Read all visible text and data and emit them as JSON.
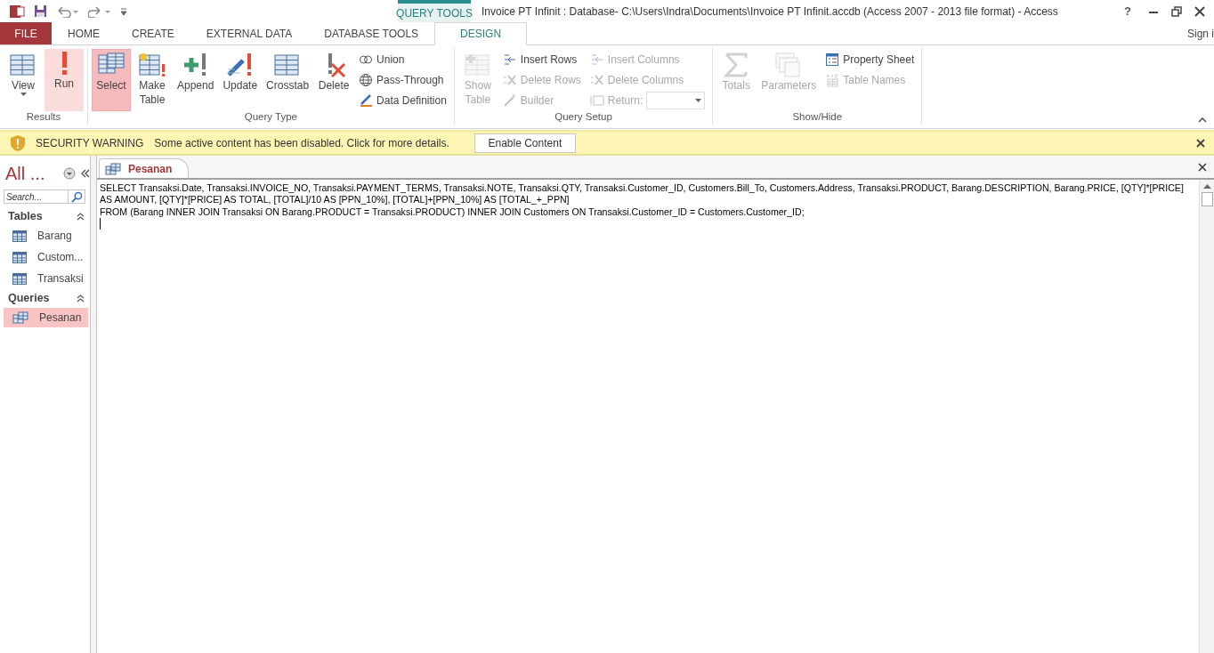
{
  "title_bar": {
    "context_tab": "QUERY TOOLS",
    "title": "Invoice PT Infinit : Database- C:\\Users\\Indra\\Documents\\Invoice PT Infinit.accdb (Access 2007 - 2013 file format) - Access",
    "help": "?"
  },
  "ribbon_tabs": [
    {
      "label": "FILE",
      "kind": "file",
      "selected": false
    },
    {
      "label": "HOME",
      "kind": "tab",
      "selected": false
    },
    {
      "label": "CREATE",
      "kind": "tab",
      "selected": false
    },
    {
      "label": "EXTERNAL DATA",
      "kind": "tab",
      "selected": false
    },
    {
      "label": "DATABASE TOOLS",
      "kind": "tab",
      "selected": false
    },
    {
      "label": "DESIGN",
      "kind": "tab",
      "selected": true
    }
  ],
  "sign_in": "Sign i",
  "ribbon_groups": [
    {
      "label": "Results",
      "items": [
        {
          "label": "View",
          "kind": "large",
          "selected": false,
          "highlighted": false,
          "disabled": false,
          "dropdown": true
        },
        {
          "label": "Run",
          "kind": "large",
          "selected": false,
          "highlighted": true,
          "disabled": false
        }
      ]
    },
    {
      "label": "Query Type",
      "items": [
        {
          "label": "Select",
          "kind": "large",
          "selected": true,
          "highlighted": false,
          "disabled": false
        },
        {
          "label": "Make Table",
          "kind": "large",
          "selected": false,
          "highlighted": false,
          "disabled": false
        },
        {
          "label": "Append",
          "kind": "large",
          "selected": false,
          "highlighted": false,
          "disabled": false
        },
        {
          "label": "Update",
          "kind": "large",
          "selected": false,
          "highlighted": false,
          "disabled": false
        },
        {
          "label": "Crosstab",
          "kind": "large",
          "selected": false,
          "highlighted": false,
          "disabled": false
        },
        {
          "label": "Delete",
          "kind": "large",
          "selected": false,
          "highlighted": false,
          "disabled": false
        },
        {
          "label": "Union",
          "kind": "small",
          "disabled": false
        },
        {
          "label": "Pass-Through",
          "kind": "small",
          "disabled": false
        },
        {
          "label": "Data Definition",
          "kind": "small",
          "disabled": false
        }
      ]
    },
    {
      "label": "Query Setup",
      "items": [
        {
          "label": "Show Table",
          "kind": "large",
          "selected": false,
          "highlighted": false,
          "disabled": true
        },
        {
          "label": "Insert Rows",
          "kind": "small",
          "disabled": false
        },
        {
          "label": "Delete Rows",
          "kind": "small",
          "disabled": true
        },
        {
          "label": "Builder",
          "kind": "small",
          "disabled": true
        },
        {
          "label": "Insert Columns",
          "kind": "small",
          "disabled": true
        },
        {
          "label": "Delete Columns",
          "kind": "small",
          "disabled": true
        },
        {
          "label": "Return:",
          "kind": "combo",
          "disabled": true
        }
      ]
    },
    {
      "label": "Show/Hide",
      "items": [
        {
          "label": "Totals",
          "kind": "large",
          "selected": false,
          "highlighted": false,
          "disabled": true
        },
        {
          "label": "Parameters",
          "kind": "large",
          "selected": false,
          "highlighted": false,
          "disabled": true
        },
        {
          "label": "Property Sheet",
          "kind": "small",
          "disabled": false
        },
        {
          "label": "Table Names",
          "kind": "small",
          "disabled": true
        }
      ]
    }
  ],
  "message_bar": {
    "heading": "SECURITY WARNING",
    "message": "Some active content has been disabled. Click for more details.",
    "button": "Enable Content"
  },
  "nav_pane": {
    "title": "All ...",
    "search": {
      "placeholder": "Search..."
    },
    "sections": [
      {
        "label": "Tables",
        "expanded": true,
        "items": [
          {
            "label": "Barang",
            "kind": "table",
            "selected": false
          },
          {
            "label": "Custom...",
            "kind": "table",
            "selected": false
          },
          {
            "label": "Transaksi",
            "kind": "table",
            "selected": false
          }
        ]
      },
      {
        "label": "Queries",
        "expanded": true,
        "items": [
          {
            "label": "Pesanan",
            "kind": "query",
            "selected": true
          }
        ]
      }
    ]
  },
  "document": {
    "tab": "Pesanan",
    "sql_lines": [
      "SELECT Transaksi.Date, Transaksi.INVOICE_NO, Transaksi.PAYMENT_TERMS, Transaksi.NOTE, Transaksi.QTY, Transaksi.Customer_ID, Customers.Bill_To, Customers.Address, Transaksi.PRODUCT, Barang.DESCRIPTION, Barang.PRICE, [QTY]*[PRICE]",
      "AS AMOUNT, [QTY]*[PRICE] AS TOTAL, [TOTAL]/10 AS [PPN_10%], [TOTAL]+[PPN_10%] AS [TOTAL_+_PPN]",
      "FROM (Barang INNER JOIN Transaksi ON Barang.PRODUCT = Transaksi.PRODUCT) INNER JOIN Customers ON Transaksi.Customer_ID = Customers.Customer_ID;"
    ]
  }
}
